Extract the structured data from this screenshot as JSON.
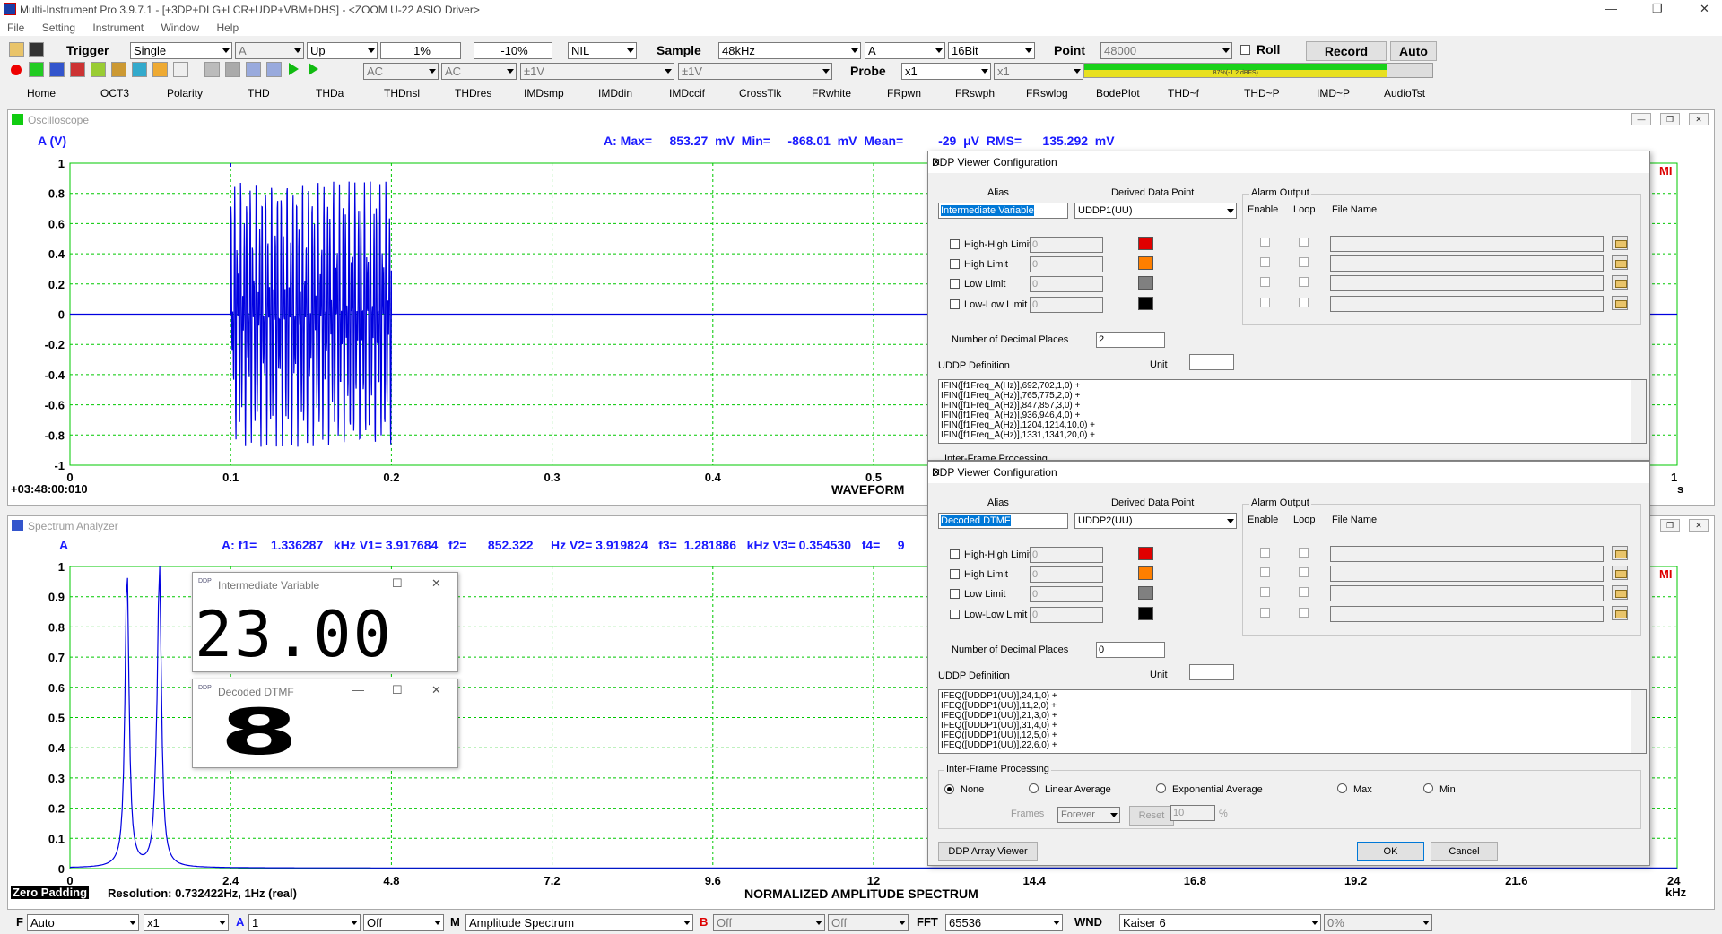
{
  "window": {
    "title": "Multi-Instrument Pro 3.9.7.1  -  [+3DP+DLG+LCR+UDP+VBM+DHS]  -  <ZOOM U-22 ASIO Driver>"
  },
  "menu": [
    "File",
    "Setting",
    "Instrument",
    "Window",
    "Help"
  ],
  "toolbar1": {
    "trigger_label": "Trigger",
    "trigger_mode": "Single",
    "channel": "A",
    "edge": "Up",
    "level": "1%",
    "delay": "-10%",
    "nil": "NIL",
    "sample_label": "Sample",
    "sample_rate": "48kHz",
    "sample_channel": "A",
    "bit_depth": "16Bit",
    "point_label": "Point",
    "points": "48000",
    "roll_label": "Roll",
    "record_label": "Record",
    "auto_label": "Auto"
  },
  "toolbar2": {
    "coupling_a": "AC",
    "coupling_b": "AC",
    "range_a": "±1V",
    "range_b": "±1V",
    "probe_label": "Probe",
    "probe_a": "x1",
    "probe_b": "x1",
    "level_meter": "87%(-1.2 dBFS)"
  },
  "tabs": [
    "Home",
    "OCT3",
    "Polarity",
    "THD",
    "THDa",
    "THDnsl",
    "THDres",
    "IMDsmp",
    "IMDdin",
    "IMDccif",
    "CrossTlk",
    "FRwhite",
    "FRpwn",
    "FRswph",
    "FRswlog",
    "BodePlot",
    "THD~f",
    "THD~P",
    "IMD~P",
    "AudioTst"
  ],
  "oscilloscope": {
    "title": "Oscilloscope",
    "y_unit": "A (V)",
    "measure": "A: Max=     853.27  mV  Min=     -868.01  mV  Mean=          -29  μV  RMS=      135.292  mV",
    "y_ticks": [
      "1",
      "0.8",
      "0.6",
      "0.4",
      "0.2",
      "0",
      "-0.2",
      "-0.4",
      "-0.6",
      "-0.8",
      "-1"
    ],
    "x_ticks": [
      "0",
      "0.1",
      "0.2",
      "0.3",
      "0.4",
      "0.5"
    ],
    "x_end": "1",
    "x_unit": "s",
    "timestamp": "+03:48:00:010",
    "x_label": "WAVEFORM"
  },
  "spectrum": {
    "title": "Spectrum Analyzer",
    "y_unit": "A",
    "measure": "A: f1=    1.336287   kHz V1= 3.917684   f2=      852.322     Hz V2= 3.919824   f3=  1.281886   kHz V3= 0.354530   f4=     9",
    "y_ticks": [
      "1",
      "0.9",
      "0.8",
      "0.7",
      "0.6",
      "0.5",
      "0.4",
      "0.3",
      "0.2",
      "0.1",
      "0"
    ],
    "x_ticks": [
      "0",
      "2.4",
      "4.8",
      "7.2",
      "9.6",
      "12",
      "14.4",
      "16.8",
      "19.2",
      "21.6"
    ],
    "x_end": "24",
    "x_unit": "kHz",
    "zero_padding": "Zero Padding",
    "resolution": "Resolution: 0.732422Hz, 1Hz (real)",
    "x_label": "NORMALIZED AMPLITUDE SPECTRUM"
  },
  "mi_badge": "MI",
  "viewer1": {
    "title": "Intermediate Variable",
    "value": "23.00"
  },
  "viewer2": {
    "title": "Decoded DTMF",
    "value": "8"
  },
  "dlg1": {
    "title": "DDP Viewer Configuration",
    "alias_label": "Alias",
    "alias": "Intermediate Variable",
    "ddp_label": "Derived Data Point",
    "ddp": "UDDP1(UU)",
    "alarm_label": "Alarm Output",
    "enable": "Enable",
    "loop": "Loop",
    "file_name": "File Name",
    "limits": [
      "High-High Limit",
      "High Limit",
      "Low Limit",
      "Low-Low Limit"
    ],
    "limit_value": "0",
    "decimal_label": "Number of Decimal Places",
    "decimals": "2",
    "def_label": "UDDP Definition",
    "unit_label": "Unit",
    "definition": "IFIN([f1Freq_A(Hz)],692,702,1,0) +\nIFIN([f1Freq_A(Hz)],765,775,2,0) +\nIFIN([f1Freq_A(Hz)],847,857,3,0) +\nIFIN([f1Freq_A(Hz)],936,946,4,0) +\nIFIN([f1Freq_A(Hz)],1204,1214,10,0) +\nIFIN([f1Freq_A(Hz)],1331,1341,20,0) +",
    "ifp_label": "Inter-Frame Processing"
  },
  "dlg2": {
    "title": "DDP Viewer Configuration",
    "alias_label": "Alias",
    "alias": "Decoded DTMF",
    "ddp_label": "Derived Data Point",
    "ddp": "UDDP2(UU)",
    "alarm_label": "Alarm Output",
    "enable": "Enable",
    "loop": "Loop",
    "file_name": "File Name",
    "limits": [
      "High-High Limit",
      "High Limit",
      "Low Limit",
      "Low-Low Limit"
    ],
    "limit_value": "0",
    "decimal_label": "Number of Decimal Places",
    "decimals": "0",
    "def_label": "UDDP Definition",
    "unit_label": "Unit",
    "definition": "IFEQ([UDDP1(UU)],24,1,0) +\nIFEQ([UDDP1(UU)],11,2,0) +\nIFEQ([UDDP1(UU)],21,3,0) +\nIFEQ([UDDP1(UU)],31,4,0) +\nIFEQ([UDDP1(UU)],12,5,0) +\nIFEQ([UDDP1(UU)],22,6,0) +",
    "ifp_label": "Inter-Frame Processing",
    "ifp_options": [
      "None",
      "Linear Average",
      "Exponential Average",
      "Max",
      "Min"
    ],
    "frames_label": "Frames",
    "frames": "Forever",
    "reset": "Reset",
    "exp_value": "10",
    "pct": "%",
    "array_viewer": "DDP Array Viewer",
    "ok": "OK",
    "cancel": "Cancel"
  },
  "bottom": {
    "f_label": "F",
    "f_value": "Auto",
    "zoom": "x1",
    "a_label": "A",
    "a_value": "1",
    "a_off": "Off",
    "m_label": "M",
    "m_value": "Amplitude Spectrum",
    "b_label": "B",
    "b_value": "Off",
    "b_off": "Off",
    "fft_label": "FFT",
    "fft": "65536",
    "wnd_label": "WND",
    "wnd": "Kaiser 6",
    "overlap": "0%"
  }
}
